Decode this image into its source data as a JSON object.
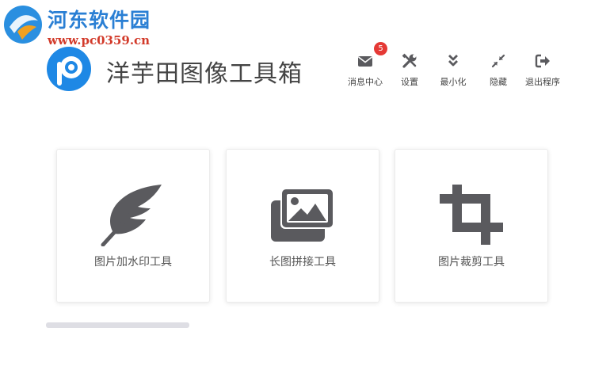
{
  "watermark": {
    "title": "河东软件园",
    "url": "www.pc0359.cn"
  },
  "app": {
    "title": "洋芋田图像工具箱"
  },
  "toolbar": {
    "messages": {
      "label": "消息中心",
      "badge": "5",
      "icon": "envelope-icon"
    },
    "settings": {
      "label": "设置",
      "icon": "wrench-screwdriver-icon"
    },
    "minimize": {
      "label": "最小化",
      "icon": "double-chevron-down-icon"
    },
    "hide": {
      "label": "隐藏",
      "icon": "compress-arrows-icon"
    },
    "exit": {
      "label": "退出程序",
      "icon": "sign-out-icon"
    }
  },
  "tools": [
    {
      "label": "图片加水印工具",
      "icon": "feather-icon"
    },
    {
      "label": "长图拼接工具",
      "icon": "images-icon"
    },
    {
      "label": "图片裁剪工具",
      "icon": "crop-icon"
    }
  ],
  "colors": {
    "icon": "#5a5a5e",
    "badge": "#e53935",
    "accent": "#1e88e5",
    "progress_track": "#dedee4"
  }
}
